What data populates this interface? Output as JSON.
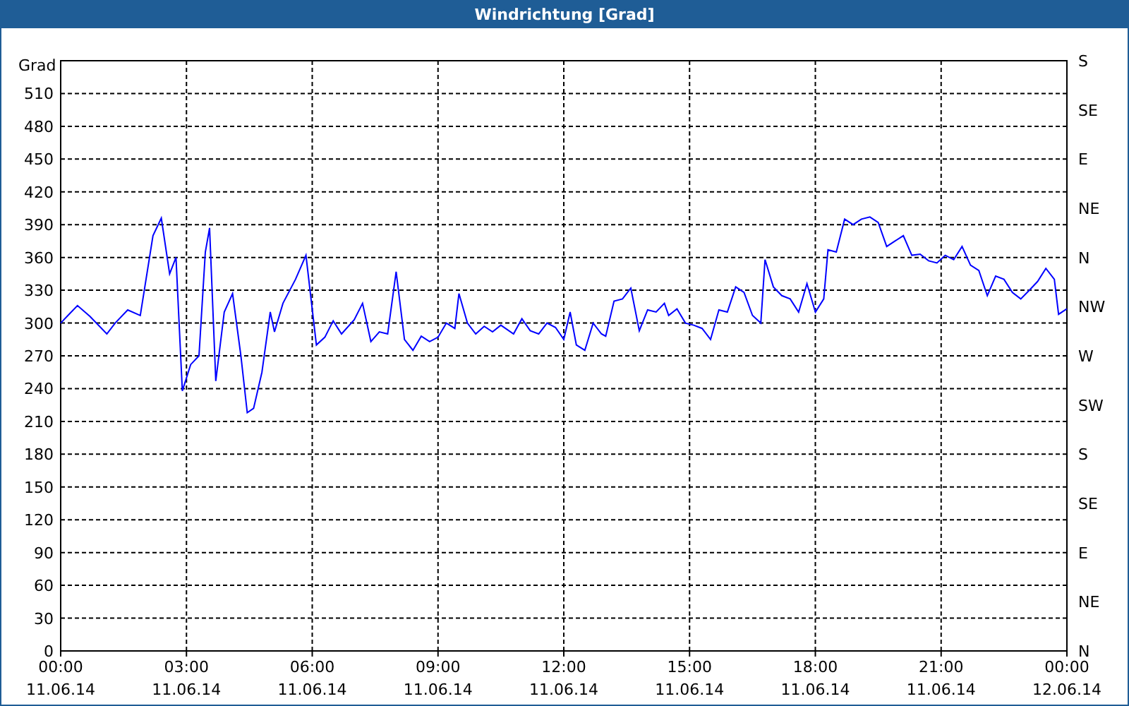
{
  "chart": {
    "chart_data": {
      "type": "line",
      "title": "Windrichtung [Grad]",
      "grid": true,
      "ylabel": "Grad",
      "xlim": [
        0,
        24
      ],
      "ylim": [
        0,
        540
      ],
      "yticks": [
        0,
        30,
        60,
        90,
        120,
        150,
        180,
        210,
        240,
        270,
        300,
        330,
        360,
        390,
        420,
        450,
        480,
        510
      ],
      "xticks": [
        {
          "value": 0,
          "label": "00:00"
        },
        {
          "value": 3,
          "label": "03:00"
        },
        {
          "value": 6,
          "label": "06:00"
        },
        {
          "value": 9,
          "label": "09:00"
        },
        {
          "value": 12,
          "label": "12:00"
        },
        {
          "value": 15,
          "label": "15:00"
        },
        {
          "value": 18,
          "label": "18:00"
        },
        {
          "value": 21,
          "label": "21:00"
        },
        {
          "value": 24,
          "label": "00:00"
        }
      ],
      "x": [
        0,
        0.2,
        0.4,
        0.7,
        1.1,
        1.3,
        1.6,
        1.9,
        2.2,
        2.4,
        2.6,
        2.75,
        2.9,
        3.1,
        3.3,
        3.45,
        3.55,
        3.7,
        3.9,
        4.1,
        4.3,
        4.45,
        4.6,
        4.8,
        5.0,
        5.1,
        5.3,
        5.6,
        5.85,
        6.1,
        6.3,
        6.5,
        6.7,
        7.0,
        7.2,
        7.4,
        7.6,
        7.8,
        8.0,
        8.2,
        8.4,
        8.6,
        8.8,
        9.0,
        9.2,
        9.4,
        9.5,
        9.7,
        9.9,
        10.1,
        10.3,
        10.5,
        10.8,
        11.0,
        11.2,
        11.4,
        11.6,
        11.8,
        12.0,
        12.15,
        12.3,
        12.5,
        12.7,
        12.9,
        13.0,
        13.2,
        13.4,
        13.6,
        13.8,
        14.0,
        14.2,
        14.4,
        14.5,
        14.7,
        14.9,
        15.1,
        15.3,
        15.5,
        15.7,
        15.9,
        16.1,
        16.3,
        16.5,
        16.7,
        16.8,
        17.0,
        17.2,
        17.4,
        17.6,
        17.8,
        18.0,
        18.2,
        18.3,
        18.5,
        18.7,
        18.9,
        19.1,
        19.3,
        19.5,
        19.7,
        19.9,
        20.1,
        20.3,
        20.5,
        20.7,
        20.9,
        21.1,
        21.3,
        21.5,
        21.7,
        21.9,
        22.1,
        22.3,
        22.5,
        22.7,
        22.9,
        23.1,
        23.3,
        23.5,
        23.7,
        23.8,
        24.0
      ],
      "series": [
        {
          "color": "#0000ff",
          "values": [
            300,
            308,
            316,
            306,
            290,
            300,
            312,
            307,
            380,
            396,
            345,
            360,
            238,
            262,
            270,
            365,
            387,
            247,
            310,
            327,
            270,
            218,
            222,
            255,
            310,
            292,
            318,
            340,
            362,
            280,
            287,
            302,
            290,
            303,
            318,
            283,
            292,
            290,
            347,
            285,
            275,
            288,
            283,
            287,
            300,
            295,
            327,
            300,
            290,
            297,
            292,
            298,
            290,
            304,
            293,
            290,
            300,
            296,
            285,
            310,
            280,
            275,
            300,
            290,
            288,
            320,
            322,
            332,
            293,
            312,
            310,
            318,
            307,
            313,
            300,
            298,
            295,
            285,
            312,
            310,
            333,
            328,
            307,
            300,
            358,
            333,
            325,
            322,
            310,
            336,
            310,
            322,
            367,
            365,
            395,
            390,
            395,
            397,
            392,
            370,
            375,
            380,
            362,
            363,
            357,
            355,
            362,
            358,
            370,
            353,
            348,
            325,
            343,
            340,
            328,
            322,
            330,
            338,
            350,
            340,
            308,
            313
          ]
        }
      ]
    },
    "x_dates": [
      "11.06.14",
      "11.06.14",
      "11.06.14",
      "11.06.14",
      "11.06.14",
      "11.06.14",
      "11.06.14",
      "11.06.14",
      "12.06.14"
    ],
    "right_axis": [
      "S",
      "SE",
      "E",
      "NE",
      "N",
      "NW",
      "W",
      "SW",
      "S",
      "SE",
      "E",
      "NE",
      "N"
    ]
  }
}
